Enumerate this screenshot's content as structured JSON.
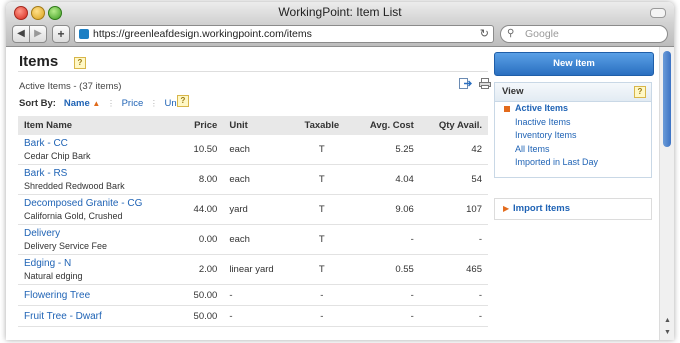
{
  "window": {
    "title": "WorkingPoint: Item List"
  },
  "browser": {
    "url": "https://greenleafdesign.workingpoint.com/items",
    "search_placeholder": "Google"
  },
  "page": {
    "title": "Items",
    "help": "?",
    "subtitle": "Active Items - (37 items)",
    "sort_label": "Sort By:",
    "sort_options": [
      "Name",
      "Price",
      "Unit"
    ],
    "sort_active": "Name"
  },
  "table": {
    "columns": [
      "Item Name",
      "Price",
      "Unit",
      "Taxable",
      "Avg. Cost",
      "Qty Avail."
    ],
    "rows": [
      {
        "name": "Bark - CC",
        "description": "Cedar Chip Bark",
        "price": "10.50",
        "unit": "each",
        "taxable": "T",
        "avg_cost": "5.25",
        "qty": "42"
      },
      {
        "name": "Bark - RS",
        "description": "Shredded Redwood Bark",
        "price": "8.00",
        "unit": "each",
        "taxable": "T",
        "avg_cost": "4.04",
        "qty": "54"
      },
      {
        "name": "Decomposed Granite - CG",
        "description": "California Gold, Crushed",
        "price": "44.00",
        "unit": "yard",
        "taxable": "T",
        "avg_cost": "9.06",
        "qty": "107"
      },
      {
        "name": "Delivery",
        "description": "Delivery Service Fee",
        "price": "0.00",
        "unit": "each",
        "taxable": "T",
        "avg_cost": "-",
        "qty": "-"
      },
      {
        "name": "Edging - N",
        "description": "Natural edging",
        "price": "2.00",
        "unit": "linear yard",
        "taxable": "T",
        "avg_cost": "0.55",
        "qty": "465"
      },
      {
        "name": "Flowering Tree",
        "description": "",
        "price": "50.00",
        "unit": "-",
        "taxable": "-",
        "avg_cost": "-",
        "qty": "-"
      },
      {
        "name": "Fruit Tree - Dwarf",
        "description": "",
        "price": "50.00",
        "unit": "-",
        "taxable": "-",
        "avg_cost": "-",
        "qty": "-"
      }
    ]
  },
  "sidebar": {
    "new_item": "New Item",
    "view_title": "View",
    "view_items": [
      "Active Items",
      "Inactive Items",
      "Inventory Items",
      "All Items",
      "Imported in Last Day"
    ],
    "import_label": "Import Items"
  },
  "colors": {
    "link": "#1f63b5",
    "accent": "#e36b1c",
    "button": "#2a6fc0"
  }
}
